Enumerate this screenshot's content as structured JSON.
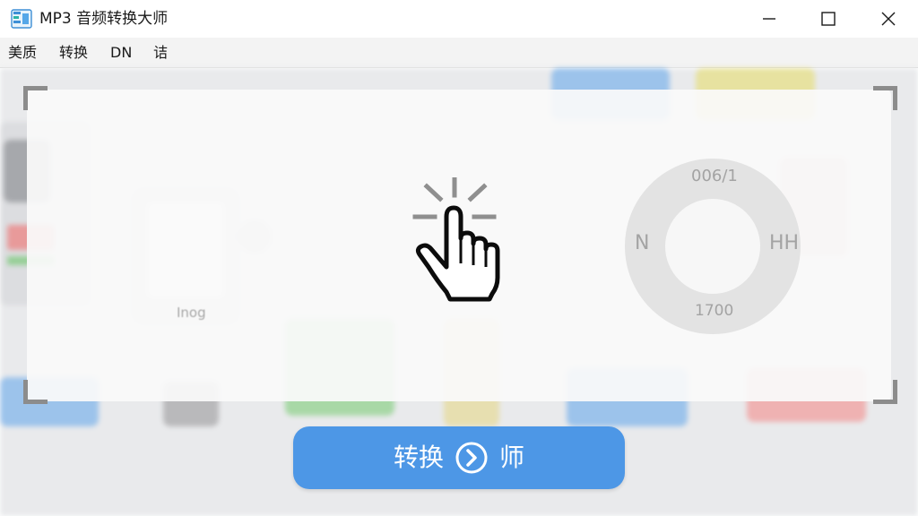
{
  "window": {
    "title": "MP3 音频转换大师"
  },
  "menu": {
    "items": [
      {
        "label": "美质"
      },
      {
        "label": "转换"
      },
      {
        "label": "DN"
      },
      {
        "label": "诘"
      }
    ]
  },
  "background": {
    "faded_label": "Inog"
  },
  "dial": {
    "top": "006/1",
    "bottom": "1700",
    "left": "N",
    "right": "HH"
  },
  "convert_button": {
    "label": "转换",
    "suffix": "师"
  },
  "colors": {
    "accent": "#4d97e6",
    "titlebar": "#ffffff",
    "menubar": "#f3f3f3"
  },
  "icons": {
    "app": "app-logo-icon",
    "cursor": "pointer-hand-icon",
    "convert": "arrow-circle-right-icon"
  }
}
